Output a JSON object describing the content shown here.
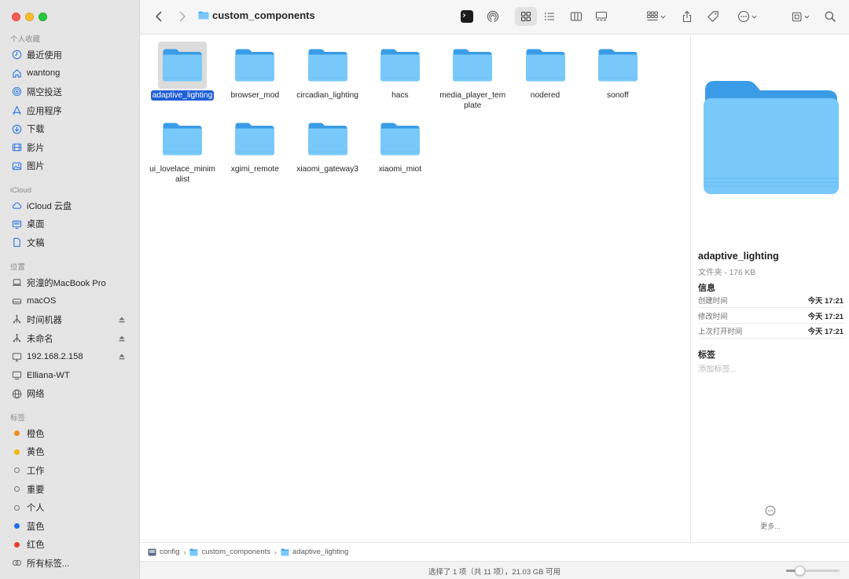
{
  "toolbar": {
    "title": "custom_components",
    "icons": [
      "back-icon",
      "forward-icon",
      "terminal-icon",
      "airdrop-icon",
      "grid-view-icon",
      "list-view-icon",
      "column-view-icon",
      "gallery-view-icon",
      "group-icon",
      "share-icon",
      "tag-icon",
      "more-icon",
      "device-icon",
      "search-icon"
    ]
  },
  "sidebar": {
    "favorites_title": "个人收藏",
    "favorites": [
      {
        "label": "最近使用",
        "icon": "clock-icon"
      },
      {
        "label": "wantong",
        "icon": "home-icon"
      },
      {
        "label": "隔空投送",
        "icon": "airdrop-icon"
      },
      {
        "label": "应用程序",
        "icon": "apps-icon"
      },
      {
        "label": "下载",
        "icon": "download-icon"
      },
      {
        "label": "影片",
        "icon": "movie-icon"
      },
      {
        "label": "图片",
        "icon": "photo-icon"
      }
    ],
    "icloud_title": "iCloud",
    "icloud": [
      {
        "label": "iCloud 云盘",
        "icon": "cloud-icon"
      },
      {
        "label": "桌面",
        "icon": "desktop-icon"
      },
      {
        "label": "文稿",
        "icon": "document-icon"
      }
    ],
    "locations_title": "位置",
    "locations": [
      {
        "label": "宛潼的MacBook Pro",
        "icon": "laptop-icon",
        "eject": false
      },
      {
        "label": "macOS",
        "icon": "disk-icon",
        "eject": false
      },
      {
        "label": "时间机器",
        "icon": "network-drive-icon",
        "eject": true
      },
      {
        "label": "未命名",
        "icon": "network-drive-icon",
        "eject": true
      },
      {
        "label": "192.168.2.158",
        "icon": "monitor-icon",
        "eject": true
      },
      {
        "label": "Elliana-WT",
        "icon": "display-icon",
        "eject": false
      },
      {
        "label": "网络",
        "icon": "globe-icon",
        "eject": false
      }
    ],
    "tags_title": "标签",
    "tags": [
      {
        "label": "橙色",
        "color": "#f08a24"
      },
      {
        "label": "黄色",
        "color": "#f4b400"
      },
      {
        "label": "工作",
        "color": ""
      },
      {
        "label": "重要",
        "color": ""
      },
      {
        "label": "个人",
        "color": ""
      },
      {
        "label": "蓝色",
        "color": "#1f6fe8"
      },
      {
        "label": "红色",
        "color": "#ea3b32"
      },
      {
        "label": "所有标签...",
        "color": "all"
      }
    ]
  },
  "files": [
    {
      "name": "adaptive_lighting",
      "selected": true
    },
    {
      "name": "browser_mod",
      "selected": false
    },
    {
      "name": "circadian_lighting",
      "selected": false
    },
    {
      "name": "hacs",
      "selected": false
    },
    {
      "name": "media_player_template",
      "selected": false
    },
    {
      "name": "nodered",
      "selected": false
    },
    {
      "name": "sonoff",
      "selected": false
    },
    {
      "name": "ui_lovelace_minimalist",
      "selected": false
    },
    {
      "name": "xgimi_remote",
      "selected": false
    },
    {
      "name": "xiaomi_gateway3",
      "selected": false
    },
    {
      "name": "xiaomi_miot",
      "selected": false
    }
  ],
  "preview": {
    "name": "adaptive_lighting",
    "kind": "文件夹 - 176 KB",
    "info_title": "信息",
    "info": [
      {
        "key": "创建时间",
        "value": "今天 17:21"
      },
      {
        "key": "修改时间",
        "value": "今天 17:21"
      },
      {
        "key": "上次打开时间",
        "value": "今天 17:21"
      }
    ],
    "tags_title": "标签",
    "tags_placeholder": "添加标签...",
    "more_label": "更多..."
  },
  "pathbar": [
    "config",
    "custom_components",
    "adaptive_lighting"
  ],
  "status": {
    "text": "选择了 1 项（共 11 项），21.03 GB 可用",
    "zoom_fraction": 0.26
  },
  "colors": {
    "accent": "#1f5fd6",
    "folder_light": "#78c8f9",
    "folder_dark": "#3a9ce6",
    "sidebar_bg": "#e6e5e5"
  }
}
